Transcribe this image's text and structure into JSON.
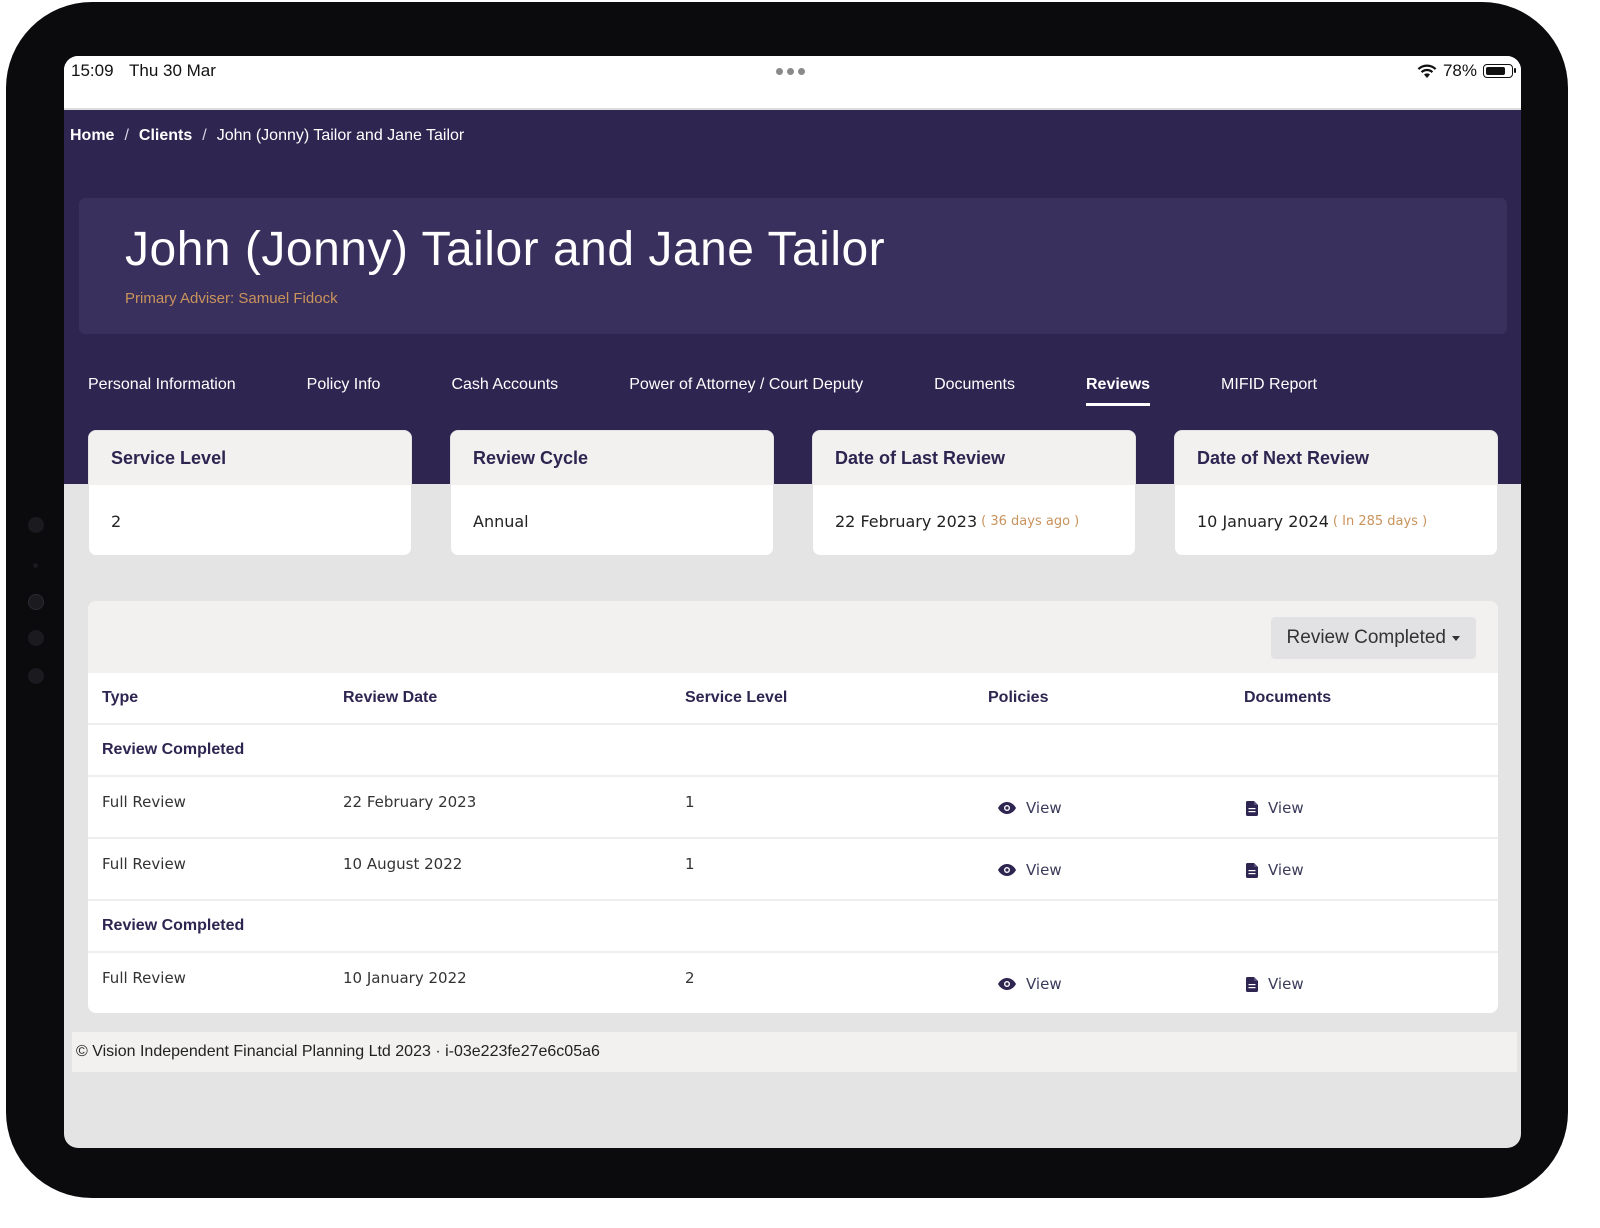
{
  "status_bar": {
    "time": "15:09",
    "date": "Thu 30 Mar",
    "battery": "78%",
    "battery_level": 0.78
  },
  "breadcrumb": {
    "home": "Home",
    "separator": "/",
    "clients": "Clients",
    "current": "John (Jonny) Tailor and Jane Tailor"
  },
  "client": {
    "name": "John (Jonny) Tailor and Jane Tailor",
    "adviser": "Primary Adviser: Samuel Fidock"
  },
  "tabs": [
    {
      "label": "Personal Information",
      "active": false
    },
    {
      "label": "Policy Info",
      "active": false
    },
    {
      "label": "Cash Accounts",
      "active": false
    },
    {
      "label": "Power of Attorney / Court Deputy",
      "active": false
    },
    {
      "label": "Documents",
      "active": false
    },
    {
      "label": "Reviews",
      "active": true
    },
    {
      "label": "MIFID Report",
      "active": false
    }
  ],
  "cards": [
    {
      "title": "Service Level",
      "value": "2",
      "hint": ""
    },
    {
      "title": "Review Cycle",
      "value": "Annual",
      "hint": ""
    },
    {
      "title": "Date of Last Review",
      "value": "22 February 2023",
      "hint": "( 36 days ago )"
    },
    {
      "title": "Date of Next Review",
      "value": "10 January 2024",
      "hint": "( In 285 days )"
    }
  ],
  "filter": {
    "label": "Review Completed"
  },
  "table": {
    "headers": [
      "Type",
      "Review Date",
      "Service Level",
      "Policies",
      "Documents"
    ],
    "groups": [
      {
        "label": "Review Completed",
        "rows": [
          {
            "type": "Full Review",
            "date": "22 February 2023",
            "service_level": "1",
            "policies": "View",
            "documents": "View"
          },
          {
            "type": "Full Review",
            "date": "10 August 2022",
            "service_level": "1",
            "policies": "View",
            "documents": "View"
          }
        ]
      },
      {
        "label": "Review Completed",
        "rows": [
          {
            "type": "Full Review",
            "date": "10 January 2022",
            "service_level": "2",
            "policies": "View",
            "documents": "View"
          }
        ]
      }
    ]
  },
  "footer": {
    "text": "© Vision Independent Financial Planning Ltd 2023 · i-03e223fe27e6c05a6"
  },
  "colors": {
    "brand_purple": "#2e2550",
    "accent_gold": "#c9935c"
  },
  "icons": {
    "policies": "eye-icon",
    "documents": "file-icon"
  }
}
